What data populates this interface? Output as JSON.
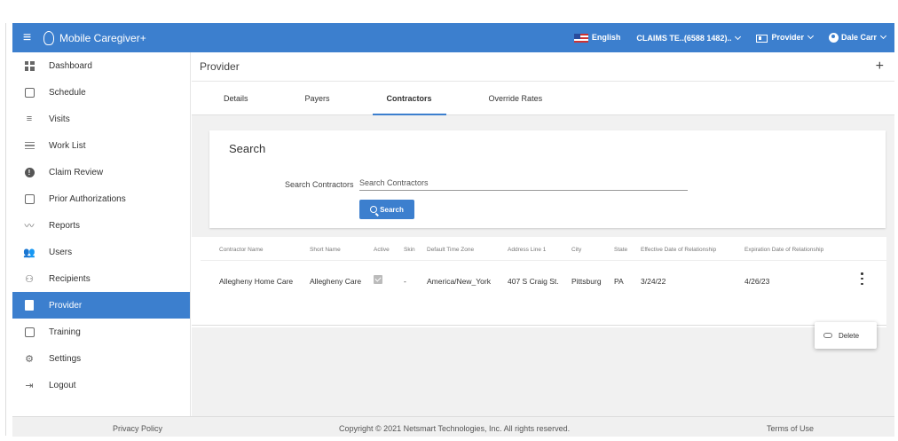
{
  "topbar": {
    "app_name": "Mobile Caregiver+",
    "language": "English",
    "claims_label": "CLAIMS TE..(6588 1482)..",
    "provider_label": "Provider",
    "user_name": "Dale Carr",
    "brand_color": "#3c7fce"
  },
  "sidebar": {
    "items": [
      {
        "label": "Dashboard",
        "icon": "dashboard-icon"
      },
      {
        "label": "Schedule",
        "icon": "calendar-icon"
      },
      {
        "label": "Visits",
        "icon": "filter-icon"
      },
      {
        "label": "Work List",
        "icon": "list-icon"
      },
      {
        "label": "Claim Review",
        "icon": "alert-icon"
      },
      {
        "label": "Prior Authorizations",
        "icon": "calendar-check-icon"
      },
      {
        "label": "Reports",
        "icon": "chart-line-icon"
      },
      {
        "label": "Users",
        "icon": "users-icon"
      },
      {
        "label": "Recipients",
        "icon": "recipients-icon"
      },
      {
        "label": "Provider",
        "icon": "provider-icon",
        "active": true
      },
      {
        "label": "Training",
        "icon": "training-icon"
      },
      {
        "label": "Settings",
        "icon": "gear-icon"
      },
      {
        "label": "Logout",
        "icon": "logout-icon"
      }
    ]
  },
  "page": {
    "title": "Provider",
    "tabs": [
      "Details",
      "Payers",
      "Contractors",
      "Override Rates"
    ],
    "active_tab": "Contractors"
  },
  "search": {
    "title": "Search",
    "field_label": "Search Contractors",
    "placeholder": "Search Contractors",
    "button_label": "Search"
  },
  "table": {
    "headers": [
      "Contractor Name",
      "Short Name",
      "Active",
      "Skin",
      "Default Time Zone",
      "Address Line 1",
      "City",
      "State",
      "Effective Date of Relationship",
      "Expiration Date of Relationship"
    ],
    "rows": [
      {
        "contractor_name": "Allegheny Home Care",
        "short_name": "Allegheny Care",
        "active": true,
        "skin": "-",
        "time_zone": "America/New_York",
        "address": "407 S Craig St.",
        "city": "Pittsburg",
        "state": "PA",
        "effective_date": "3/24/22",
        "expiration_date": "4/26/23"
      }
    ]
  },
  "context_menu": {
    "delete_label": "Delete"
  },
  "footer": {
    "privacy": "Privacy Policy",
    "copyright": "Copyright © 2021 Netsmart Technologies, Inc. All rights reserved.",
    "terms": "Terms of Use"
  }
}
